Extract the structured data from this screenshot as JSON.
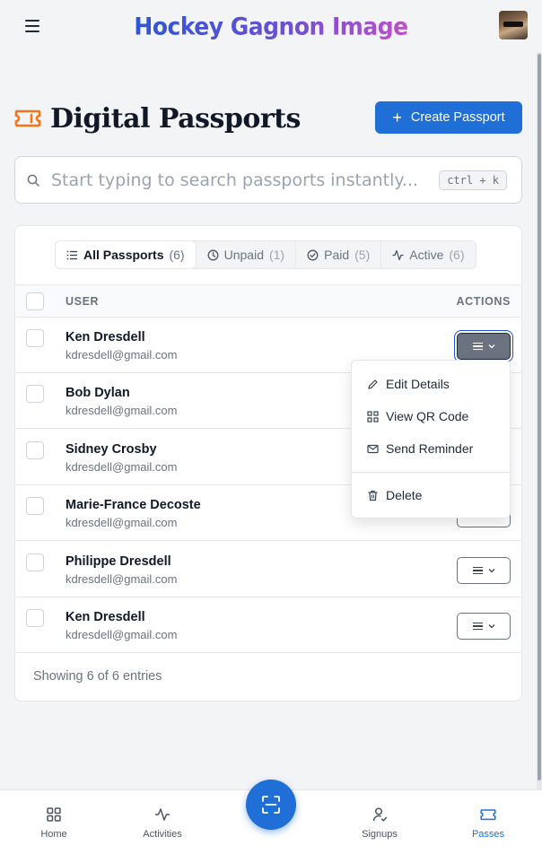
{
  "header": {
    "brand": "Hockey Gagnon Image",
    "menu_icon": "hamburger-icon",
    "avatar_icon": "user-avatar"
  },
  "page": {
    "title": "Digital Passports",
    "title_icon": "ticket-icon",
    "create_button": "Create Passport"
  },
  "search": {
    "placeholder": "Start typing to search passports instantly...",
    "value": "",
    "shortcut": "ctrl + k"
  },
  "tabs": [
    {
      "label": "All Passports",
      "count": "(6)",
      "icon": "list-icon",
      "active": true
    },
    {
      "label": "Unpaid",
      "count": "(1)",
      "icon": "clock-icon",
      "active": false
    },
    {
      "label": "Paid",
      "count": "(5)",
      "icon": "check-circle-icon",
      "active": false
    },
    {
      "label": "Active",
      "count": "(6)",
      "icon": "activity-icon",
      "active": false
    }
  ],
  "table": {
    "columns": [
      "USER",
      "ACTIONS"
    ],
    "rows": [
      {
        "name": "Ken Dresdell",
        "email": "kdresdell@gmail.com"
      },
      {
        "name": "Bob Dylan",
        "email": "kdresdell@gmail.com"
      },
      {
        "name": "Sidney Crosby",
        "email": "kdresdell@gmail.com"
      },
      {
        "name": "Marie-France Decoste",
        "email": "kdresdell@gmail.com"
      },
      {
        "name": "Philippe Dresdell",
        "email": "kdresdell@gmail.com"
      },
      {
        "name": "Ken Dresdell",
        "email": "kdresdell@gmail.com"
      }
    ],
    "footer": "Showing 6 of 6 entries"
  },
  "menu": {
    "items": [
      {
        "label": "Edit Details",
        "icon": "pencil-icon"
      },
      {
        "label": "View QR Code",
        "icon": "qr-code-icon"
      },
      {
        "label": "Send Reminder",
        "icon": "mail-icon"
      },
      {
        "label": "Delete",
        "icon": "trash-icon"
      }
    ]
  },
  "bottom_nav": {
    "items": [
      {
        "label": "Home",
        "icon": "grid-icon",
        "active": false
      },
      {
        "label": "Activities",
        "icon": "activity-icon",
        "active": false
      },
      {
        "label": "Signups",
        "icon": "user-check-icon",
        "active": false
      },
      {
        "label": "Passes",
        "icon": "ticket-icon",
        "active": true
      }
    ],
    "scan_icon": "scan-icon"
  },
  "colors": {
    "primary": "#1f6fd6",
    "ticket_accent": "#f97316",
    "background": "#f3f4f6"
  }
}
